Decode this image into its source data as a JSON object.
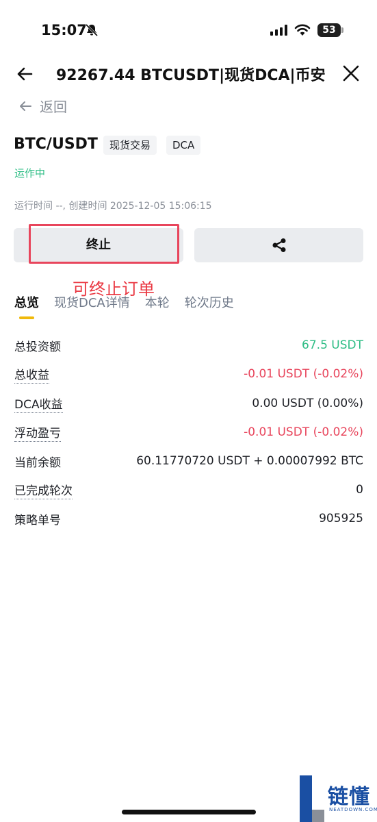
{
  "status_bar": {
    "time": "15:07",
    "battery": "53"
  },
  "nav": {
    "title": "92267.44 BTCUSDT|现货DCA|币安"
  },
  "back": {
    "label": "返回"
  },
  "pair": {
    "name": "BTC/USDT",
    "tags": [
      "现货交易",
      "DCA"
    ]
  },
  "status": "运作中",
  "meta": "运行时间 --, 创建时间 2025-12-05 15:06:15",
  "actions": {
    "stop_label": "终止",
    "annotation": "可终止订单"
  },
  "tabs": [
    {
      "label": "总览",
      "active": true
    },
    {
      "label": "现货DCA详情",
      "active": false
    },
    {
      "label": "本轮",
      "active": false
    },
    {
      "label": "轮次历史",
      "active": false
    }
  ],
  "overview": [
    {
      "label": "总投资额",
      "value": "67.5  USDT",
      "color": "green",
      "dotted": false
    },
    {
      "label": "总收益",
      "value": "-0.01  USDT  (-0.02%)",
      "color": "red",
      "dotted": true
    },
    {
      "label": "DCA收益",
      "value": "0.00  USDT  (0.00%)",
      "color": "normal",
      "dotted": true
    },
    {
      "label": "浮动盈亏",
      "value": "-0.01  USDT  (-0.02%)",
      "color": "red",
      "dotted": true
    },
    {
      "label": "当前余额",
      "value": "60.11770720 USDT + 0.00007992 BTC",
      "color": "normal",
      "dotted": false
    },
    {
      "label": "已完成轮次",
      "value": "0",
      "color": "normal",
      "dotted": true
    },
    {
      "label": "策略单号",
      "value": "905925",
      "color": "normal",
      "dotted": false
    }
  ],
  "watermark": {
    "text": "链懂",
    "sub": "NEATDOWN.COM"
  },
  "colors": {
    "green": "#2ebd85",
    "red": "#e8455c",
    "accent": "#f0b90b",
    "annotation": "#ea3943"
  },
  "icons": [
    "bell-slash-icon",
    "signal-icon",
    "wifi-icon",
    "battery-icon",
    "back-arrow-icon",
    "close-icon",
    "share-icon"
  ]
}
